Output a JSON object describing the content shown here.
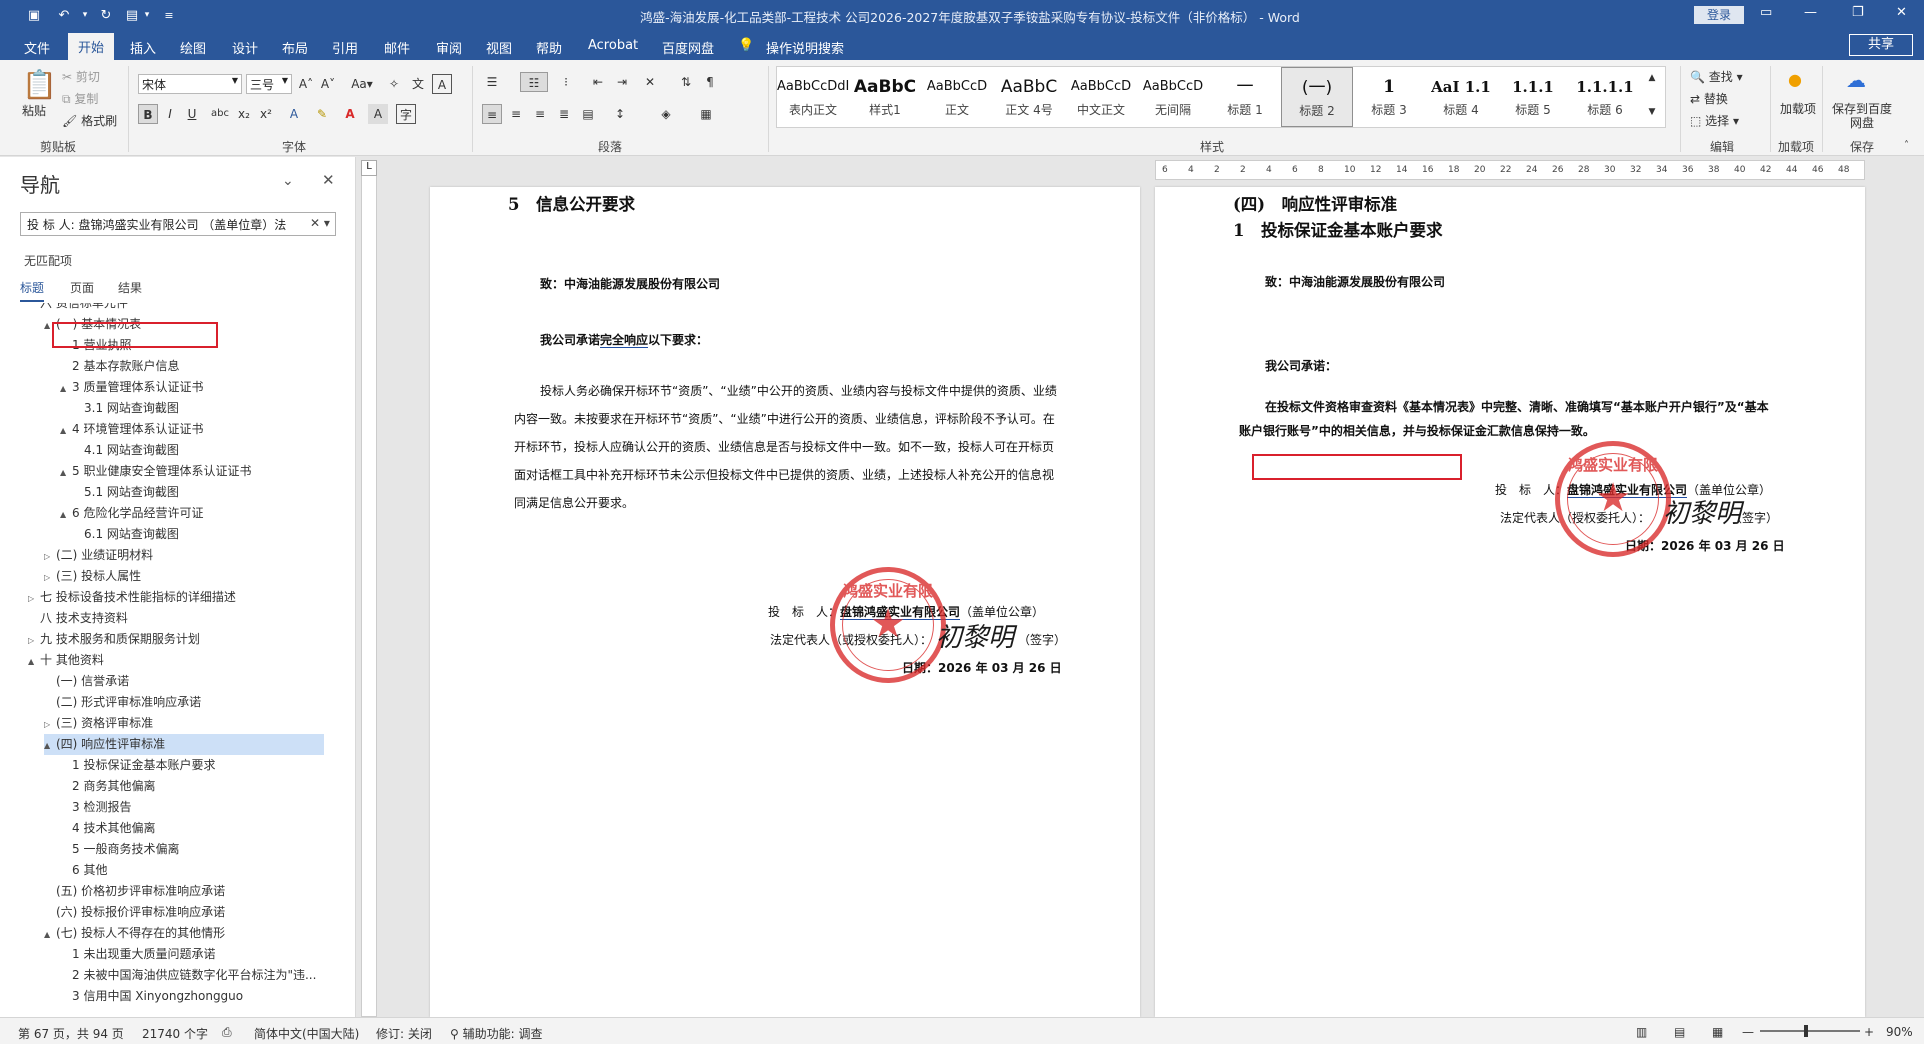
{
  "window": {
    "title": "鸿盛-海油发展-化工品类部-工程技术 公司2026-2027年度胺基双子季铵盐采购专有协议-投标文件（非价格标） - Word",
    "login": "登录",
    "share": "共享"
  },
  "tabs": [
    "文件",
    "开始",
    "插入",
    "绘图",
    "设计",
    "布局",
    "引用",
    "邮件",
    "审阅",
    "视图",
    "帮助",
    "Acrobat",
    "百度网盘",
    "操作说明搜索"
  ],
  "ribbon": {
    "clipboard": {
      "paste": "粘贴",
      "cut": "剪切",
      "copy": "复制",
      "format_painter": "格式刷",
      "label": "剪贴板"
    },
    "font": {
      "font_name": "宋体",
      "font_size": "三号",
      "label": "字体"
    },
    "paragraph": {
      "label": "段落"
    },
    "styles": {
      "label": "样式",
      "items": [
        {
          "preview": "AaBbCcDdI",
          "name": "表内正文"
        },
        {
          "preview": "AaBbC",
          "name": "样式1"
        },
        {
          "preview": "AaBbCcD",
          "name": "正文"
        },
        {
          "preview": "AaBbC",
          "name": "正文 4号"
        },
        {
          "preview": "AaBbCcD",
          "name": "中文正文"
        },
        {
          "preview": "AaBbCcD",
          "name": "无间隔"
        },
        {
          "preview": "一",
          "name": "标题 1"
        },
        {
          "preview": "(一)",
          "name": "标题 2"
        },
        {
          "preview": "1",
          "name": "标题 3"
        },
        {
          "preview": "AaI 1.1",
          "name": "标题 4"
        },
        {
          "preview": "1.1.1",
          "name": "标题 5"
        },
        {
          "preview": "1.1.1.1",
          "name": "标题 6"
        }
      ]
    },
    "editing": {
      "find": "查找",
      "replace": "替换",
      "select": "选择",
      "label": "编辑"
    },
    "addin": {
      "btn": "加载项",
      "label": "加载项"
    },
    "save": {
      "btn": "保存到百度网盘",
      "label": "保存"
    }
  },
  "nav": {
    "title": "导航",
    "search_value": "投 标 人: 盘锦鸿盛实业有限公司 （盖单位章）法",
    "no_match": "无匹配项",
    "tabs": [
      "标题",
      "页面",
      "结果"
    ],
    "items": [
      {
        "text": "六 资信标单元件",
        "indent": 0,
        "toggle": ""
      },
      {
        "text": "(一) 基本情况表",
        "indent": 1,
        "toggle": "▲"
      },
      {
        "text": "1 营业执照",
        "indent": 2,
        "toggle": ""
      },
      {
        "text": "2 基本存款账户信息",
        "indent": 2,
        "toggle": ""
      },
      {
        "text": "3 质量管理体系认证证书",
        "indent": 2,
        "toggle": "▲"
      },
      {
        "text": "3.1 网站查询截图",
        "indent": 3,
        "toggle": ""
      },
      {
        "text": "4 环境管理体系认证证书",
        "indent": 2,
        "toggle": "▲"
      },
      {
        "text": "4.1 网站查询截图",
        "indent": 3,
        "toggle": ""
      },
      {
        "text": "5 职业健康安全管理体系认证证书",
        "indent": 2,
        "toggle": "▲"
      },
      {
        "text": "5.1 网站查询截图",
        "indent": 3,
        "toggle": ""
      },
      {
        "text": "6 危险化学品经营许可证",
        "indent": 2,
        "toggle": "▲"
      },
      {
        "text": "6.1 网站查询截图",
        "indent": 3,
        "toggle": ""
      },
      {
        "text": "(二) 业绩证明材料",
        "indent": 1,
        "toggle": "▷"
      },
      {
        "text": "(三) 投标人属性",
        "indent": 1,
        "toggle": "▷"
      },
      {
        "text": "七 投标设备技术性能指标的详细描述",
        "indent": 0,
        "toggle": "▷"
      },
      {
        "text": "八 技术支持资料",
        "indent": 0,
        "toggle": ""
      },
      {
        "text": "九 技术服务和质保期服务计划",
        "indent": 0,
        "toggle": "▷"
      },
      {
        "text": "十 其他资料",
        "indent": 0,
        "toggle": "▲"
      },
      {
        "text": "(一) 信誉承诺",
        "indent": 1,
        "toggle": ""
      },
      {
        "text": "(二) 形式评审标准响应承诺",
        "indent": 1,
        "toggle": ""
      },
      {
        "text": "(三) 资格评审标准",
        "indent": 1,
        "toggle": "▷"
      },
      {
        "text": "(四) 响应性评审标准",
        "indent": 1,
        "toggle": "▲"
      },
      {
        "text": "1 投标保证金基本账户要求",
        "indent": 2,
        "toggle": ""
      },
      {
        "text": "2 商务其他偏离",
        "indent": 2,
        "toggle": ""
      },
      {
        "text": "3 检测报告",
        "indent": 2,
        "toggle": ""
      },
      {
        "text": "4 技术其他偏离",
        "indent": 2,
        "toggle": ""
      },
      {
        "text": "5 一般商务技术偏离",
        "indent": 2,
        "toggle": ""
      },
      {
        "text": "6 其他",
        "indent": 2,
        "toggle": ""
      },
      {
        "text": "(五) 价格初步评审标准响应承诺",
        "indent": 1,
        "toggle": ""
      },
      {
        "text": "(六) 投标报价评审标准响应承诺",
        "indent": 1,
        "toggle": ""
      },
      {
        "text": "(七) 投标人不得存在的其他情形",
        "indent": 1,
        "toggle": "▲"
      },
      {
        "text": "1 未出现重大质量问题承诺",
        "indent": 2,
        "toggle": ""
      },
      {
        "text": "2 未被中国海油供应链数字化平台标注为\"违...",
        "indent": 2,
        "toggle": ""
      },
      {
        "text": "3 信用中国 Xinyongzhongguo",
        "indent": 2,
        "toggle": ""
      }
    ]
  },
  "page1": {
    "heading": "5　信息公开要求",
    "to": "致：中海油能源发展股份有限公司",
    "promise_prefix": "我公司承诺",
    "promise_link": "完全响应",
    "promise_suffix": "以下要求：",
    "body": "投标人务必确保开标环节“资质”、“业绩”中公开的资质、业绩内容与投标文件中提供的资质、业绩内容一致。未按要求在开标环节“资质”、“业绩”中进行公开的资质、业绩信息，评标阶段不予认可。在开标环节，投标人应确认公开的资质、业绩信息是否与投标文件中一致。如不一致，投标人可在开标页面对话框工具中补充开标环节未公示但投标文件中已提供的资质、业绩，上述投标人补充公开的信息视同满足信息公开要求。",
    "bidder_label": "投　标　人：",
    "bidder_name": "盘锦鸿盛实业有限公司",
    "bidder_suffix": "（盖单位公章）",
    "rep_label": "法定代表人（或授权委托人）：",
    "rep_suffix": "（签字）",
    "date": "日期：2026 年 03 月 26 日"
  },
  "page2": {
    "heading_a": "(四)　响应性评审标准",
    "heading_b": "1　投标保证金基本账户要求",
    "to": "致：中海油能源发展股份有限公司",
    "promise": "我公司承诺：",
    "body": "在投标文件资格审查资料《基本情况表》中完整、清晰、准确填写“基本账户开户银行”及“基本账户银行账号”中的相关信息，并与投标保证金汇款信息保持一致。",
    "bidder_label": "投　标　人：",
    "bidder_name": "盘锦鸿盛实业有限公司",
    "bidder_suffix": "（盖单位公章）",
    "rep_label": "法定代表人（授权委托人）：",
    "rep_suffix": "（签字）",
    "date": "日期：2026 年 03 月 26 日"
  },
  "stamp": {
    "text": "鸿盛实业有限",
    "star": "★"
  },
  "signature": "初黎明",
  "status": {
    "page": "第 67 页，共 94 页",
    "words": "21740 个字",
    "lang": "简体中文(中国大陆)",
    "track": "修订: 关闭",
    "access": "辅助功能: 调查",
    "zoom": "90%"
  }
}
